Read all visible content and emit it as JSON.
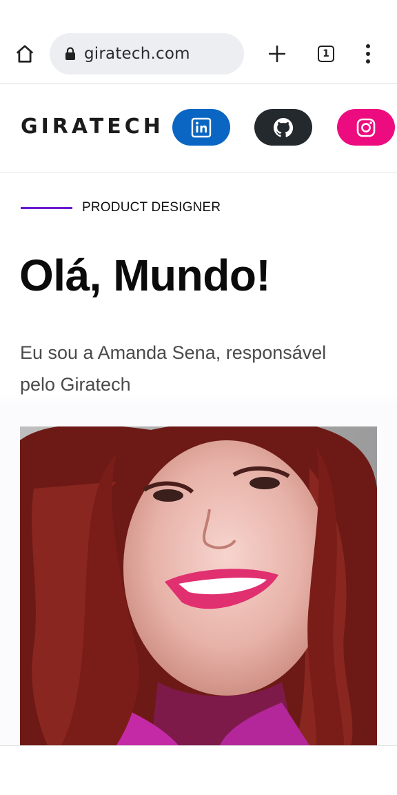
{
  "browser": {
    "url": "giratech.com",
    "tab_count": "1",
    "icons": [
      "home-icon",
      "lock-icon",
      "plus-icon",
      "tabs-icon",
      "more-vert-icon"
    ]
  },
  "site": {
    "logo": "GIRATECH",
    "social": [
      {
        "name": "linkedin",
        "icon": "linkedin-icon",
        "color": "#0a66c2"
      },
      {
        "name": "github",
        "icon": "github-icon",
        "color": "#24292e"
      },
      {
        "name": "instagram",
        "icon": "instagram-icon",
        "color": "#ec0c7f"
      }
    ]
  },
  "hero": {
    "role": "PRODUCT DESIGNER",
    "headline": "Olá, Mundo!",
    "intro": "Eu sou a Amanda Sena, responsável pelo Giratech",
    "accent_color": "#6a1bd0"
  }
}
